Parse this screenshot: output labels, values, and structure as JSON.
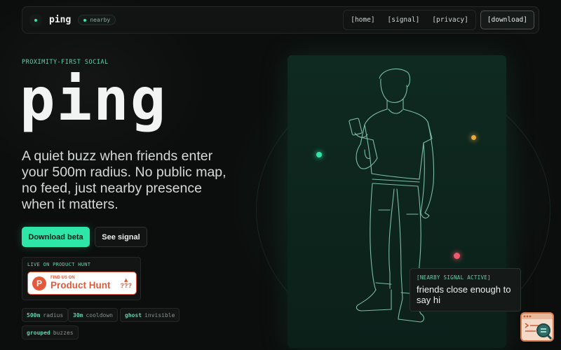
{
  "nav": {
    "brand": "ping",
    "badge": "nearby",
    "links": [
      "[home]",
      "[signal]",
      "[privacy]"
    ],
    "download": "[download]"
  },
  "hero": {
    "eyebrow": "PROXIMITY-FIRST SOCIAL",
    "title": "ping",
    "subtitle": "A quiet buzz when friends enter your 500m radius. No public map, no feed, just nearby presence when it matters.",
    "primary_cta": "Download beta",
    "secondary_cta": "See signal"
  },
  "product_hunt": {
    "label": "LIVE ON PRODUCT HUNT",
    "small": "FIND US ON",
    "big": "Product Hunt",
    "logo": "P",
    "votes": "???"
  },
  "stats": [
    {
      "value": "500m",
      "label": "radius"
    },
    {
      "value": "30m",
      "label": "cooldown"
    },
    {
      "value": "ghost",
      "label": "invisible"
    },
    {
      "value": "grouped",
      "label": "buzzes"
    }
  ],
  "signal_card": {
    "label": "[NEARBY SIGNAL ACTIVE]",
    "message": "friends close enough to say hi"
  },
  "colors": {
    "accent": "#2ee6a8",
    "background": "#0c0e0d",
    "panel": "#0f2a21",
    "dot_green": "#2ee6a8",
    "dot_amber": "#e8a93a",
    "dot_red": "#f05a6a",
    "product_hunt": "#e35a3b"
  },
  "icons": {
    "brand": "radar-dot-icon",
    "corner": "browser-search-icon"
  }
}
